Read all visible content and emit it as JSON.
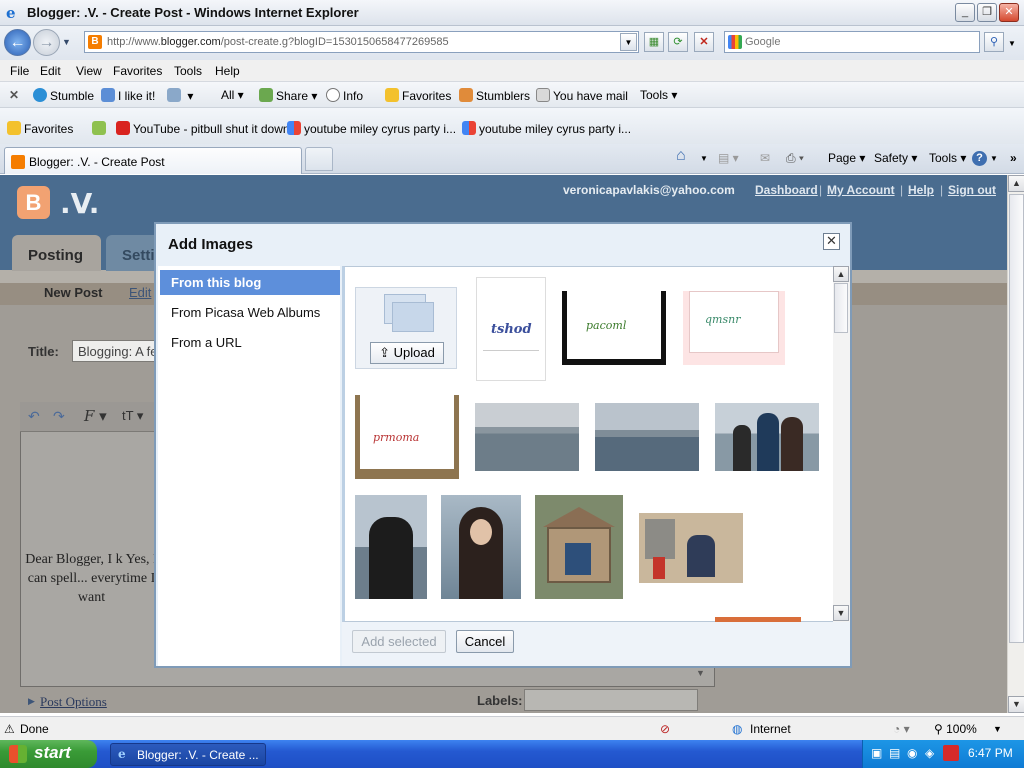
{
  "window": {
    "title": "Blogger: .V. - Create Post - Windows Internet Explorer"
  },
  "address": {
    "url_prefix": "http://www.",
    "url_domain": "blogger.com",
    "url_path": "/post-create.g?blogID=1530150658477269585",
    "search_placeholder": "Google"
  },
  "menu": [
    "File",
    "Edit",
    "View",
    "Favorites",
    "Tools",
    "Help"
  ],
  "toolbar": {
    "stumble": "Stumble",
    "ilike": "I like it!",
    "all": "All",
    "share": "Share",
    "info": "Info",
    "favorites": "Favorites",
    "stumblers": "Stumblers",
    "mail": "You have mail",
    "tools": "Tools"
  },
  "favbar": {
    "favorites": "Favorites",
    "item1": "YouTube - pitbull shut it down",
    "item2": "youtube miley cyrus party i...",
    "item3": "youtube miley cyrus party i..."
  },
  "tab": {
    "label": "Blogger: .V. - Create Post"
  },
  "commands": {
    "page": "Page",
    "safety": "Safety",
    "tools": "Tools"
  },
  "blogger": {
    "blog_title": ".V.",
    "email": "veronicapavlakis@yahoo.com",
    "links": [
      "Dashboard",
      "My Account",
      "Help",
      "Sign out"
    ],
    "tabs": [
      "Posting",
      "Setti"
    ],
    "subtabs": [
      "New Post",
      "Edit"
    ],
    "title_label": "Title:",
    "title_value": "Blogging: A fe",
    "editor_text": "Dear Blogger,  I k Yes, I can spell... everytime I want",
    "post_options": "Post Options",
    "labels": "Labels:"
  },
  "dialog": {
    "title": "Add Images",
    "nav": [
      "From this blog",
      "From Picasa Web Albums",
      "From a URL"
    ],
    "upload": "Upload",
    "add_selected": "Add selected",
    "cancel": "Cancel"
  },
  "status": {
    "text": "Done",
    "zone": "Internet",
    "zoom": "100%"
  },
  "taskbar": {
    "start": "start",
    "item": "Blogger: .V. - Create ...",
    "clock": "6:47 PM"
  }
}
